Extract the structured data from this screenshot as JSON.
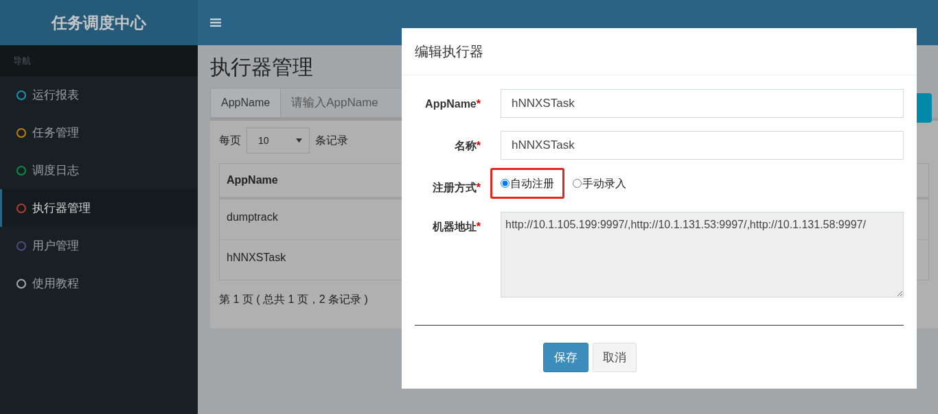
{
  "app": {
    "logo": "任务调度中心"
  },
  "sidebar": {
    "header": "导航",
    "items": [
      {
        "label": "运行报表",
        "color": "#1497b8",
        "selected": false
      },
      {
        "label": "任务管理",
        "color": "#c47c10",
        "selected": false
      },
      {
        "label": "调度日志",
        "color": "#0b8a4b",
        "selected": false
      },
      {
        "label": "执行器管理",
        "color": "#b53c2e",
        "selected": true
      },
      {
        "label": "用户管理",
        "color": "#4e4a88",
        "selected": false
      },
      {
        "label": "使用教程",
        "color": "#a8abb0",
        "selected": false
      }
    ]
  },
  "page": {
    "title": "执行器管理",
    "search": {
      "addon": "AppName",
      "placeholder": "请输入AppName"
    },
    "page_size": {
      "prefix": "每页",
      "value": "10",
      "suffix": "条记录"
    },
    "table": {
      "columns": [
        "AppName"
      ],
      "rows": [
        [
          "dumptrack"
        ],
        [
          "hNNXSTask"
        ]
      ]
    },
    "pagination": "第 1 页 ( 总共 1 页，2 条记录 )"
  },
  "modal": {
    "title": "编辑执行器",
    "fields": [
      {
        "kind": "text",
        "label": "AppName",
        "mark": "*",
        "value": "hNNXSTask"
      },
      {
        "kind": "text",
        "label": "名称",
        "mark": "*",
        "value": "hNNXSTask"
      },
      {
        "kind": "radio",
        "label": "注册方式",
        "mark": "*",
        "options": [
          {
            "label": "自动注册",
            "selected": true,
            "highlighted": true
          },
          {
            "label": "手动录入",
            "selected": false,
            "highlighted": false
          }
        ]
      },
      {
        "kind": "textarea",
        "label": "机器地址",
        "mark": "*",
        "value": "http://10.1.105.199:9997/,http://10.1.131.53:9997/,http://10.1.131.58:9997/",
        "disabled": true
      }
    ],
    "buttons": [
      {
        "label": "保存",
        "kind": "primary"
      },
      {
        "label": "取消",
        "kind": "default"
      }
    ]
  }
}
